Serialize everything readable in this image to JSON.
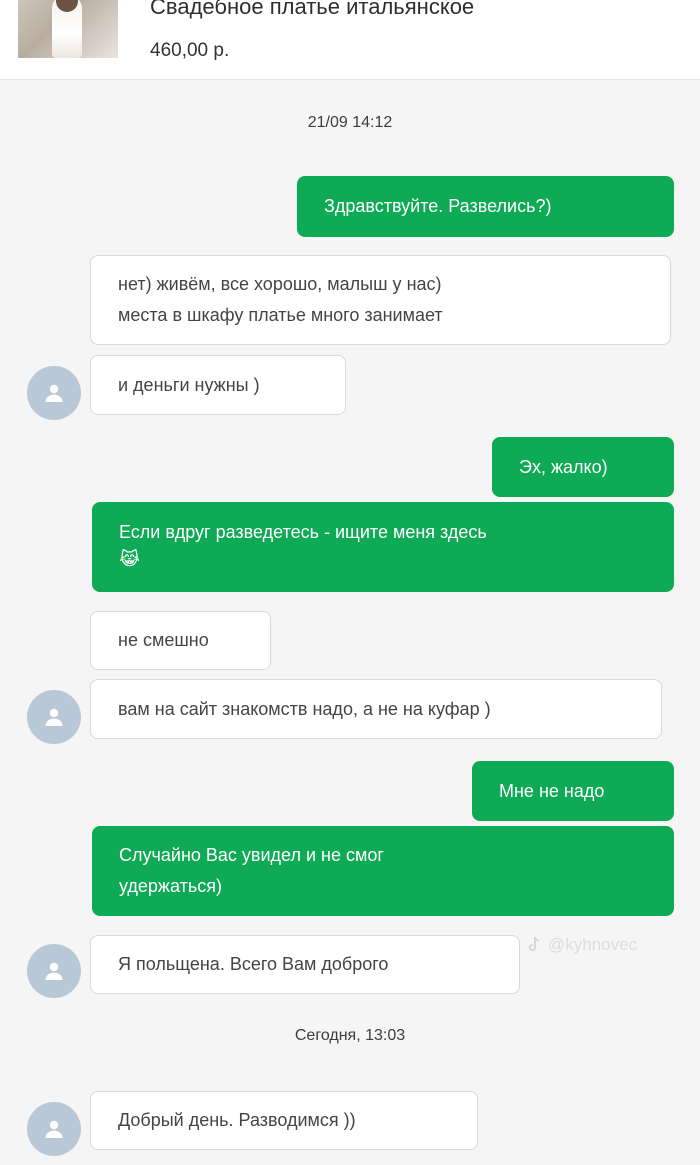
{
  "listing": {
    "title": "Свадебное платье итальянское",
    "price": "460,00 р."
  },
  "chat": {
    "timestamp_1": "21/09 14:12",
    "timestamp_2": "Сегодня, 13:03",
    "messages": [
      {
        "side": "out",
        "text": "Здравствуйте. Развелись?)"
      },
      {
        "side": "in",
        "text": "нет) живём, все хорошо, малыш у нас)\nместа в шкафу платье много занимает"
      },
      {
        "side": "in",
        "text": "и деньги нужны )"
      },
      {
        "side": "out",
        "text": "Эх, жалко)"
      },
      {
        "side": "out",
        "text": "Если вдруг разведетесь - ищите меня здесь",
        "emoji": "😹"
      },
      {
        "side": "in",
        "text": "не смешно"
      },
      {
        "side": "in",
        "text": "вам на сайт знакомств надо, а не на куфар )"
      },
      {
        "side": "out",
        "text": "Мне не надо"
      },
      {
        "side": "out",
        "text": "Случайно Вас увидел и не смог\nудержаться)"
      },
      {
        "side": "in",
        "text": "Я польщена. Всего Вам доброго"
      },
      {
        "side": "in",
        "text": "Добрый день. Разводимся ))"
      }
    ]
  },
  "watermark": {
    "text": "@kyhnovec",
    "icon": "tiktok-icon"
  },
  "colors": {
    "outgoing_bubble": "#0eaa55",
    "incoming_bubble": "#ffffff",
    "avatar": "#b9c8d6",
    "background": "#f5f5f5"
  }
}
